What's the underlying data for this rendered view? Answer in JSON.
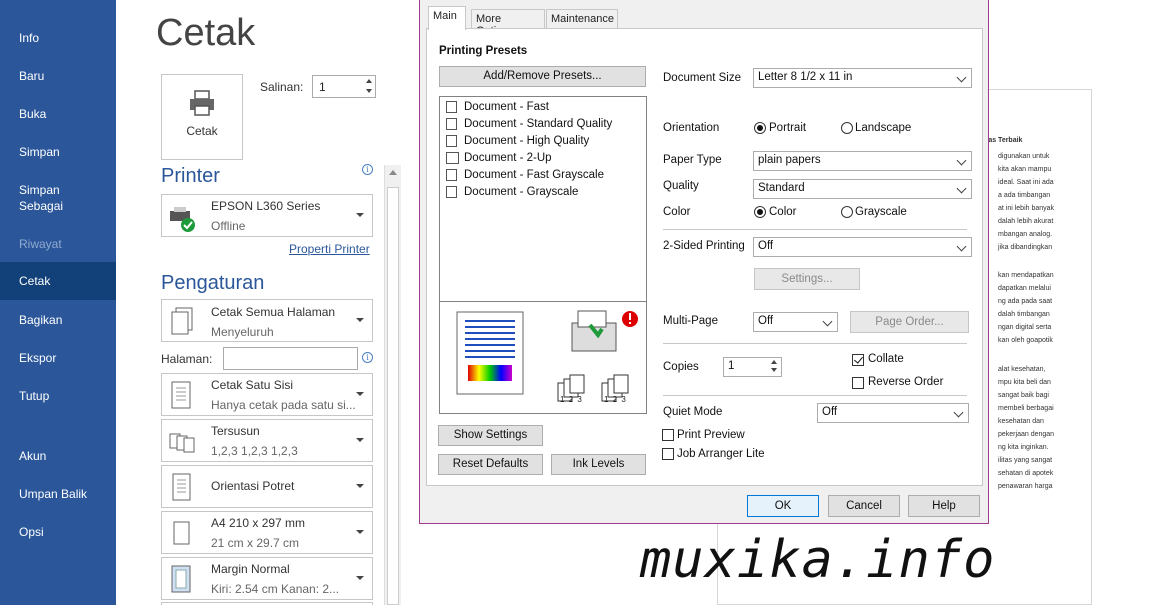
{
  "nav": {
    "items": [
      {
        "label": "Info"
      },
      {
        "label": "Baru"
      },
      {
        "label": "Buka"
      },
      {
        "label": "Simpan"
      },
      {
        "label": "Simpan Sebagai"
      },
      {
        "label": "Riwayat"
      },
      {
        "label": "Cetak"
      },
      {
        "label": "Bagikan"
      },
      {
        "label": "Ekspor"
      },
      {
        "label": "Tutup"
      },
      {
        "label": "Akun"
      },
      {
        "label": "Umpan Balik"
      },
      {
        "label": "Opsi"
      }
    ]
  },
  "print": {
    "title": "Cetak",
    "print_button": "Cetak",
    "copies_label": "Salinan:",
    "copies_value": "1"
  },
  "printer": {
    "heading": "Printer",
    "name": "EPSON L360 Series",
    "status": "Offline",
    "properties_link": "Properti Printer"
  },
  "settings": {
    "heading": "Pengaturan",
    "pages_label": "Halaman:",
    "pages_value": "",
    "items": [
      {
        "line1": "Cetak Semua Halaman",
        "line2": "Menyeluruh"
      },
      {
        "line1": "Cetak Satu Sisi",
        "line2": "Hanya cetak pada satu si..."
      },
      {
        "line1": "Tersusun",
        "line2": "1,2,3    1,2,3    1,2,3"
      },
      {
        "line1": "Orientasi Potret",
        "line2": ""
      },
      {
        "line1": "A4 210 x 297 mm",
        "line2": "21 cm x 29.7 cm"
      },
      {
        "line1": "Margin Normal",
        "line2": "Kiri: 2.54 cm   Kanan: 2..."
      }
    ]
  },
  "preview": {
    "lines": [
      "tas Terbaik",
      "digunakan untuk",
      "kita akan mampu",
      "ideal. Saat ini ada",
      "a ada timbangan",
      "at ini lebih banyak",
      "dalah lebih akurat",
      "mbangan analog.",
      "jika dibandingkan",
      "kan mendapatkan",
      "dapatkan melalui",
      "ng ada pada saat",
      "dalah timbangan",
      "ngan digital serta",
      "kan oleh goapotik",
      "alat kesehatan,",
      "mpu kita beli dan",
      "sangat baik bagi",
      "membeli berbagai",
      "kesehatan dan",
      "pekerjaan dengan",
      "ng kita inginkan.",
      "ilitas yang sangat",
      "sehatan di apotek",
      "penawaran harga"
    ],
    "watermark": "muxika.info"
  },
  "dialog": {
    "tabs": [
      "Main",
      "More Options",
      "Maintenance"
    ],
    "presets_heading": "Printing Presets",
    "add_remove": "Add/Remove Presets...",
    "presets": [
      "Document - Fast",
      "Document - Standard Quality",
      "Document - High Quality",
      "Document - 2-Up",
      "Document - Fast Grayscale",
      "Document - Grayscale"
    ],
    "preview_badges": [
      "1 2 3",
      "1 2 3"
    ],
    "show_settings": "Show Settings",
    "reset_defaults": "Reset Defaults",
    "ink_levels": "Ink Levels",
    "document_size_label": "Document Size",
    "document_size": "Letter 8 1/2 x 11 in",
    "orientation_label": "Orientation",
    "portrait": "Portrait",
    "landscape": "Landscape",
    "paper_type_label": "Paper Type",
    "paper_type": "plain papers",
    "quality_label": "Quality",
    "quality": "Standard",
    "color_label": "Color",
    "color": "Color",
    "grayscale": "Grayscale",
    "two_sided_label": "2-Sided Printing",
    "two_sided": "Off",
    "settings_btn": "Settings...",
    "multipage_label": "Multi-Page",
    "multipage": "Off",
    "page_order": "Page Order...",
    "copies_label": "Copies",
    "copies": "1",
    "collate": "Collate",
    "reverse_order": "Reverse Order",
    "quiet_mode_label": "Quiet Mode",
    "quiet_mode": "Off",
    "print_preview": "Print Preview",
    "job_arranger": "Job Arranger Lite",
    "ok": "OK",
    "cancel": "Cancel",
    "help": "Help"
  },
  "colors": {
    "nav_bg": "#2b579a",
    "nav_active": "#124078",
    "accent": "#2b579a",
    "dialog_border": "#a23a8c"
  }
}
